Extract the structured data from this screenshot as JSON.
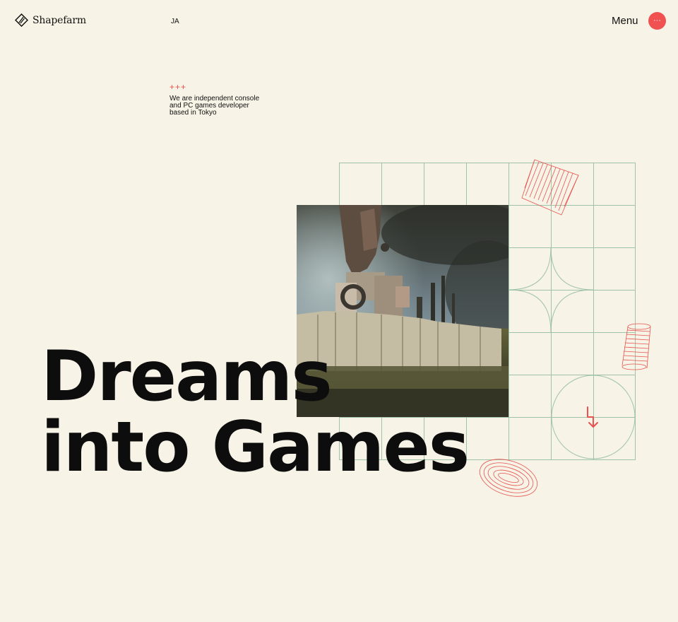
{
  "header": {
    "logo_text": "Shapefarm",
    "lang_label": "JA",
    "menu_label": "Menu",
    "menu_dots": "···"
  },
  "intro": {
    "pluses": "+++",
    "tagline": "We are independent console and PC games developer based in Tokyo"
  },
  "hero": {
    "line1": "Dreams",
    "line2": "into Games"
  },
  "colors": {
    "background": "#f7f3e6",
    "accent": "#f05252",
    "grid": "#9fc3a9",
    "text": "#0d0d0d"
  },
  "icons": {
    "logo": "shapefarm-logo-icon",
    "menu": "more-dots-icon",
    "arrow": "arrow-down-right-icon"
  }
}
